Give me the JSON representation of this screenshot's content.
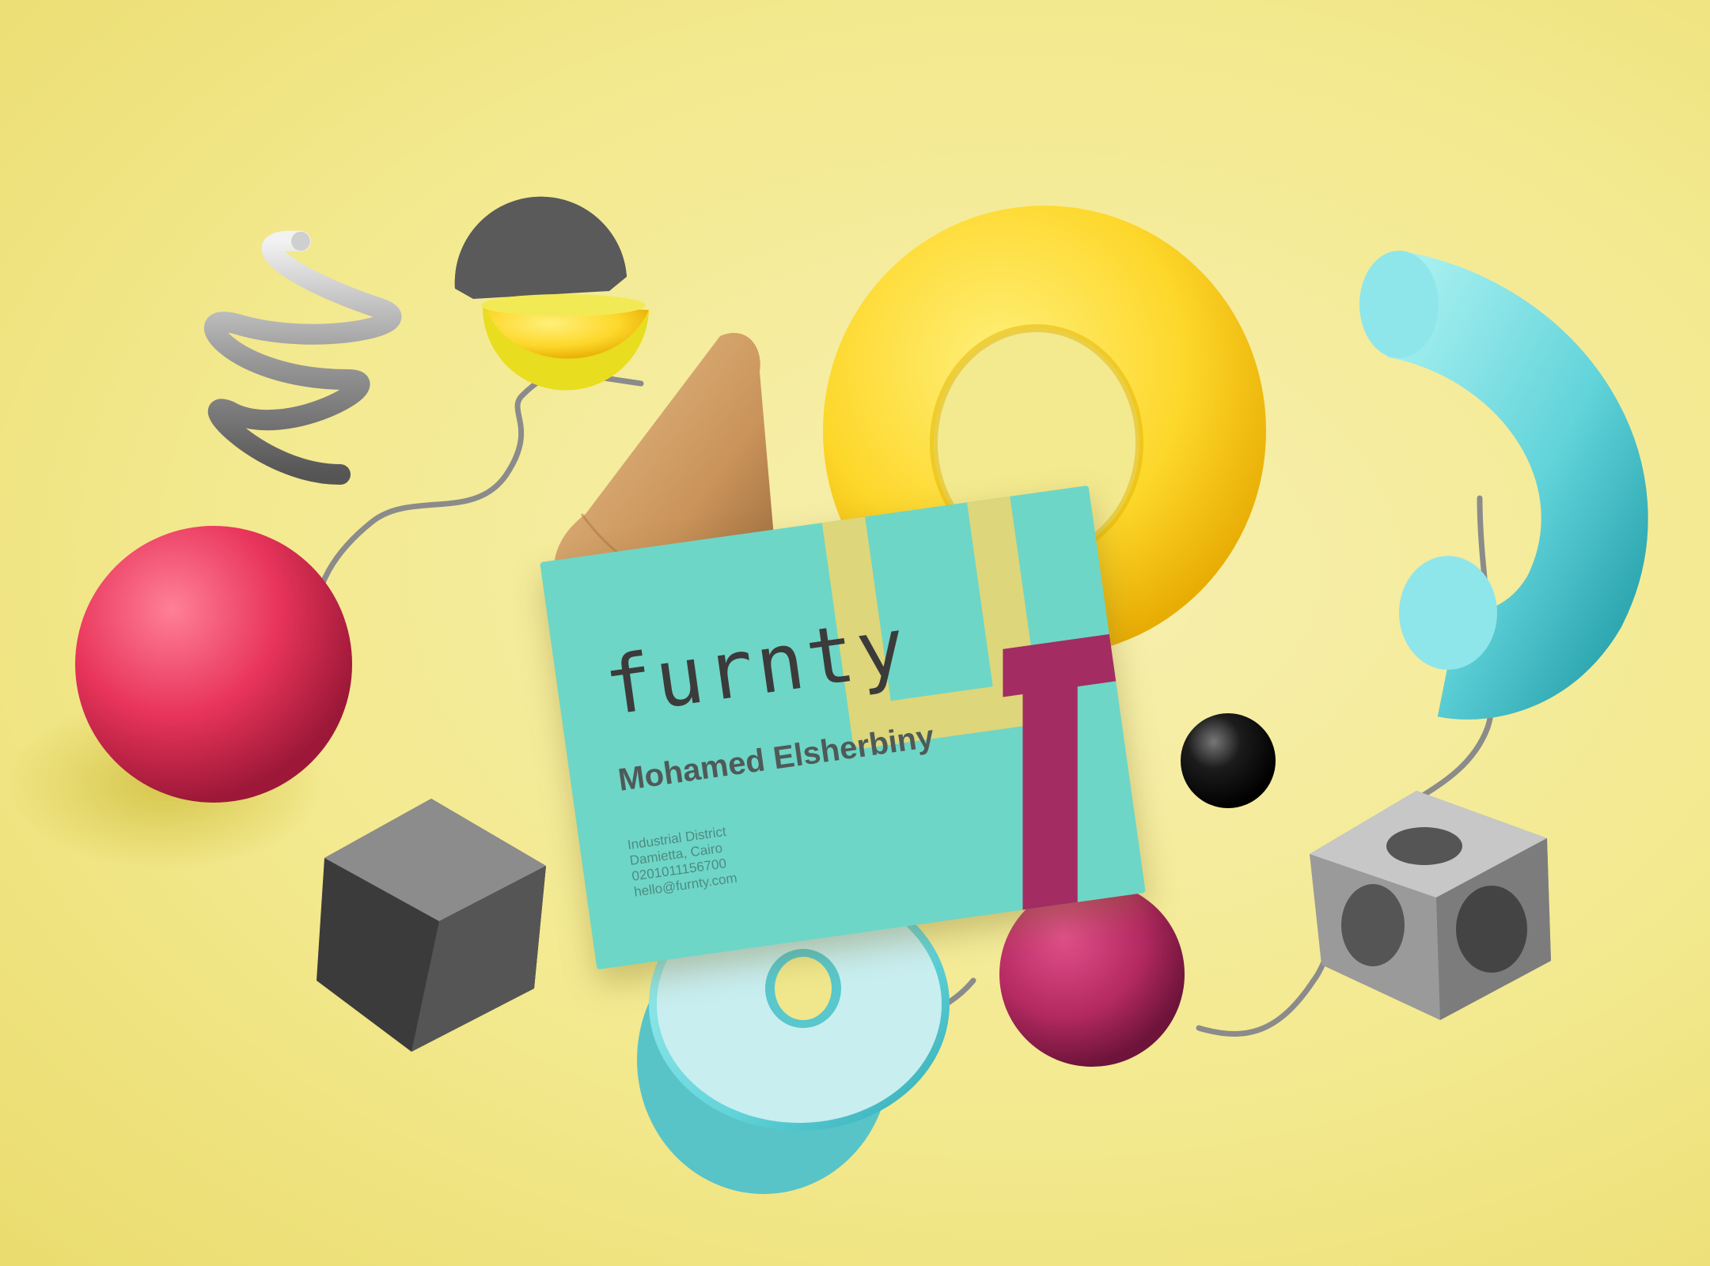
{
  "card": {
    "logo": "furnty",
    "name": "Mohamed Elsherbiny",
    "address_line1": "Industrial District",
    "address_line2": "Damietta, Cairo",
    "phone": "0201011156700",
    "email": "hello@furnty.com"
  },
  "colors": {
    "background": "#f3e98f",
    "card": "#6ed6c6",
    "card_accent_yellow": "#ddd67a",
    "card_accent_magenta": "#a32c62",
    "torus": "#fdd835",
    "pink_sphere": "#ea3a5e",
    "cyan_tube": "#6fd9df"
  },
  "objects": [
    "silver-spring",
    "half-spheres",
    "wooden-cone",
    "yellow-torus",
    "cyan-tube",
    "pink-sphere",
    "gray-cube",
    "cyan-disc",
    "black-sphere",
    "magenta-sphere",
    "metal-lattice-cube",
    "wire"
  ]
}
